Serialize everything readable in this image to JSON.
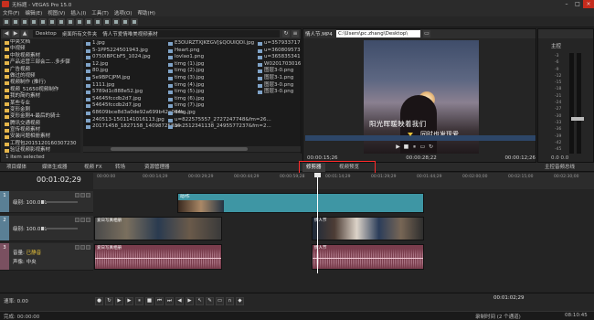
{
  "app": {
    "title": "无标题 - VEGAS Pro 15.0"
  },
  "menu": [
    "文件(F)",
    "编辑(E)",
    "视图(V)",
    "插入(I)",
    "工具(T)",
    "选项(O)",
    "帮助(H)"
  ],
  "explorer": {
    "path": [
      "Desktop",
      "桌面所有文件夹",
      "情人节爱情唯美视频素材"
    ],
    "tree": [
      "中央文档",
      "中视频",
      "中秋视频素材",
      "产品运营三部会二...多步骤",
      "广告视频",
      "做过的视频",
      "视频制作 (推行)",
      "视频_51650视频制作",
      "我的简约素材",
      "某些专业",
      "变形金刚",
      "变形金刚4-最后的骑士",
      "腾讯交通视频",
      "宣传视频素材",
      "安装问题相册素材",
      "工程包2015120160307230",
      "验证视频影视素材",
      "情人节爱情唯美视频素材"
    ],
    "selected_tree_index": 17,
    "files_col1": [
      "1.jpg",
      "5-1PP5224501943.jpg",
      "0750lBPCbF5_1024.jpg",
      "12.jpg",
      "80.jpg",
      "5e9BPCJPM.jpg",
      "1111.jpg",
      "5789d1c888e52.jpg",
      "54645fccdb2d7.jpg",
      "54645fccdb2d7.jpg",
      "68609bce8d3a0de92a699b42a044b...",
      "240513-1501141016113.jpg",
      "20171458_1827158_14098725836..."
    ],
    "files_col2": [
      "E3OURZTXJKEGV[$QOUIQDI.jpg",
      "Heart.png",
      "lovlao1.png",
      "timg (1).jpg",
      "timg (2).jpg",
      "timg (3).jpg",
      "timg (4).jpg",
      "timg (5).jpg",
      "timg (6).jpg",
      "timg (7).jpg",
      "timg.jpg",
      "u=822575557_2727247748&fm=26...",
      "u=2512341138_2495577237&fm=2..."
    ],
    "files_col3": [
      "u=3579337179...",
      "u=3608095730...",
      "u=3658353410...",
      "W02017030166...",
      "图层3-0.png",
      "图层3-1.png",
      "图层3-0.png",
      "图层3-0.png"
    ],
    "status": "1 item selected"
  },
  "preview": {
    "filename": "情人节.MP4",
    "path": "C:\\Users\\pc.zhang\\Desktop\\",
    "subtitle1": "阳光晖暖映着我们",
    "subtitle2": "同时也发现爱",
    "time_left": "00:00:15;26",
    "time_mid": "00:00:28;22",
    "time_right": "00:00:12;26",
    "controls": [
      "▶",
      "■",
      "⏸",
      "▭",
      "↻"
    ]
  },
  "mixer": {
    "label": "主控",
    "scale": [
      "-3",
      "-6",
      "-9",
      "-12",
      "-15",
      "-18",
      "-21",
      "-24",
      "-27",
      "-30",
      "-33",
      "-36",
      "-39",
      "-42",
      "-45"
    ],
    "db": "0.0  0.0",
    "fader_level": 0.35
  },
  "tabs": [
    "项目媒体",
    "媒体生成器",
    "视频 FX",
    "转场",
    "资源管理器",
    "修剪器",
    "视频预览",
    "主控音频总线"
  ],
  "active_tab": "修剪器",
  "timeline": {
    "timecode": "00:01:02;29",
    "ruler": [
      "00:00:00",
      "00:00:14;29",
      "00:00:29;29",
      "00:00:44;29",
      "00:00:59;28",
      "00:01:14;29",
      "00:01:29;29",
      "00:01:44;29",
      "00:02:00;00",
      "00:02:15;00",
      "00:02:30;00"
    ],
    "track1": {
      "label": "级别:",
      "value": "100.0 %"
    },
    "track2": {
      "label": "级别:",
      "value": "100.0 %"
    },
    "track3": {
      "label": "音量:",
      "value": "已静音",
      "label2": "声像:",
      "value2": "中央"
    },
    "clip1": "动/作",
    "clip2": "爱日写真相册",
    "clip3": "情人节",
    "clip4": "爱日写真相册",
    "clip5": "情人节",
    "rate": "速率: 0.00",
    "position": "00:01:02;29"
  },
  "status": {
    "render": "完成: 00:00:00",
    "record": "录制时间 (2 个通道)",
    "time": "08:10:45"
  }
}
